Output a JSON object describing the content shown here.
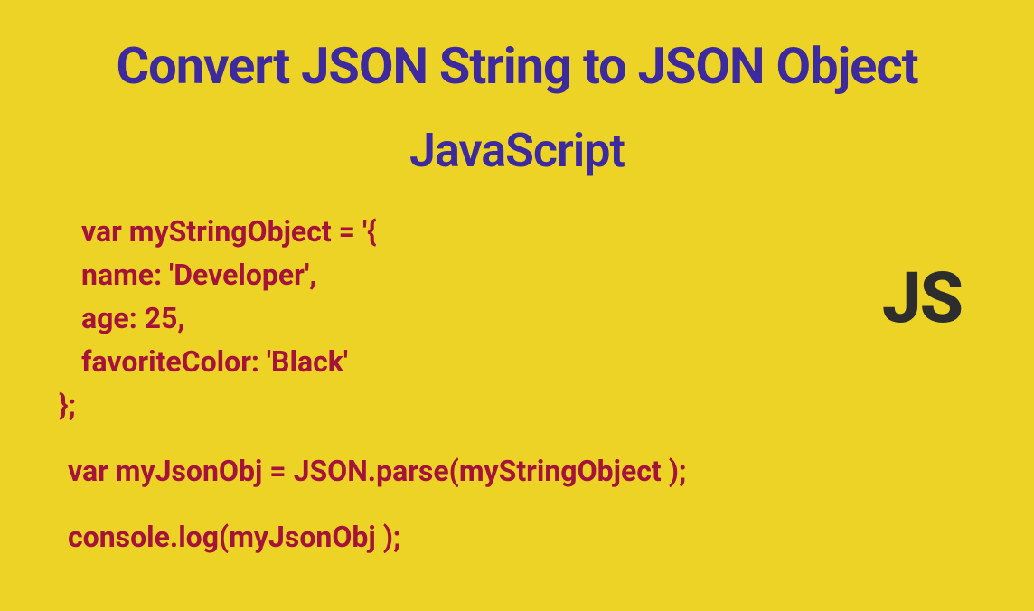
{
  "heading": "Convert JSON String to JSON Object",
  "subheading": "JavaScript",
  "code": {
    "line1": "var myStringObject = '{",
    "line2": "name: 'Developer',",
    "line3": "age: 25,",
    "line4": "favoriteColor: 'Black'",
    "line5": "};",
    "line6": "var myJsonObj = JSON.parse(myStringObject );",
    "line7": "console.log(myJsonObj );"
  },
  "badge": "JS"
}
